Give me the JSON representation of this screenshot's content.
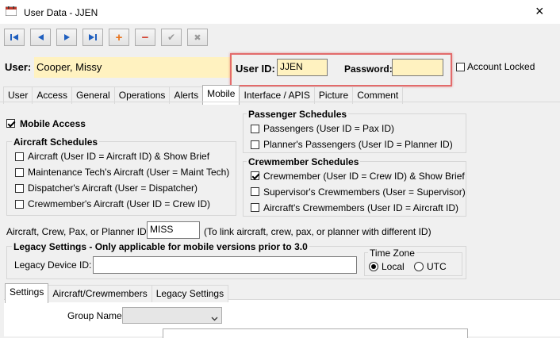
{
  "window": {
    "title": "User Data - JJEN",
    "close": "×"
  },
  "toolbar": {
    "first": "first-record",
    "prev": "previous-record",
    "next": "next-record",
    "last": "last-record",
    "add": "+",
    "delete": "−",
    "save": "✔",
    "cancel": "✖"
  },
  "header": {
    "user_label": "User:",
    "user_value": "Cooper, Missy",
    "userid_label": "User ID:",
    "userid_value": "JJEN",
    "password_label": "Password:",
    "password_value": "",
    "account_locked_label": "Account Locked"
  },
  "tabs": [
    {
      "label": "User"
    },
    {
      "label": "Access"
    },
    {
      "label": "General"
    },
    {
      "label": "Operations"
    },
    {
      "label": "Alerts"
    },
    {
      "label": "Mobile"
    },
    {
      "label": "Interface / APIS"
    },
    {
      "label": "Picture"
    },
    {
      "label": "Comment"
    }
  ],
  "mobile": {
    "mobile_access": "Mobile Access",
    "aircraft_schedules": {
      "title": "Aircraft Schedules",
      "items": [
        "Aircraft (User ID = Aircraft ID) & Show Brief",
        "Maintenance Tech's Aircraft (User = Maint Tech)",
        "Dispatcher's Aircraft (User = Dispatcher)",
        "Crewmember's Aircraft (User ID = Crew ID)"
      ]
    },
    "passenger_schedules": {
      "title": "Passenger Schedules",
      "items": [
        "Passengers (User ID = Pax ID)",
        "Planner's Passengers (User ID = Planner ID)"
      ]
    },
    "crewmember_schedules": {
      "title": "Crewmember Schedules",
      "items": [
        "Crewmember (User ID = Crew ID) & Show Brief",
        "Supervisor's Crewmembers (User = Supervisor)",
        "Aircraft's Crewmembers (User ID = Aircraft ID)"
      ]
    },
    "planner_label": "Aircraft, Crew, Pax, or Planner ID:",
    "planner_value": "MISS",
    "planner_hint": "(To link aircraft, crew, pax, or planner with different ID)",
    "legacy": {
      "title": "Legacy Settings - Only applicable for mobile versions prior to 3.0",
      "device_label": "Legacy Device ID:",
      "device_value": "",
      "timezone_title": "Time Zone",
      "local": "Local",
      "utc": "UTC"
    }
  },
  "subtabs": [
    {
      "label": "Settings"
    },
    {
      "label": "Aircraft/Crewmembers"
    },
    {
      "label": "Legacy Settings"
    }
  ],
  "settings": {
    "group_name_label": "Group Name:",
    "group_name_value": ""
  },
  "colors": {
    "highlight": "#e36b6b",
    "field_yellow": "#fff2c0",
    "nav_blue": "#1f5fbf",
    "add_orange": "#e8731c",
    "delete_red": "#d33b2a"
  }
}
